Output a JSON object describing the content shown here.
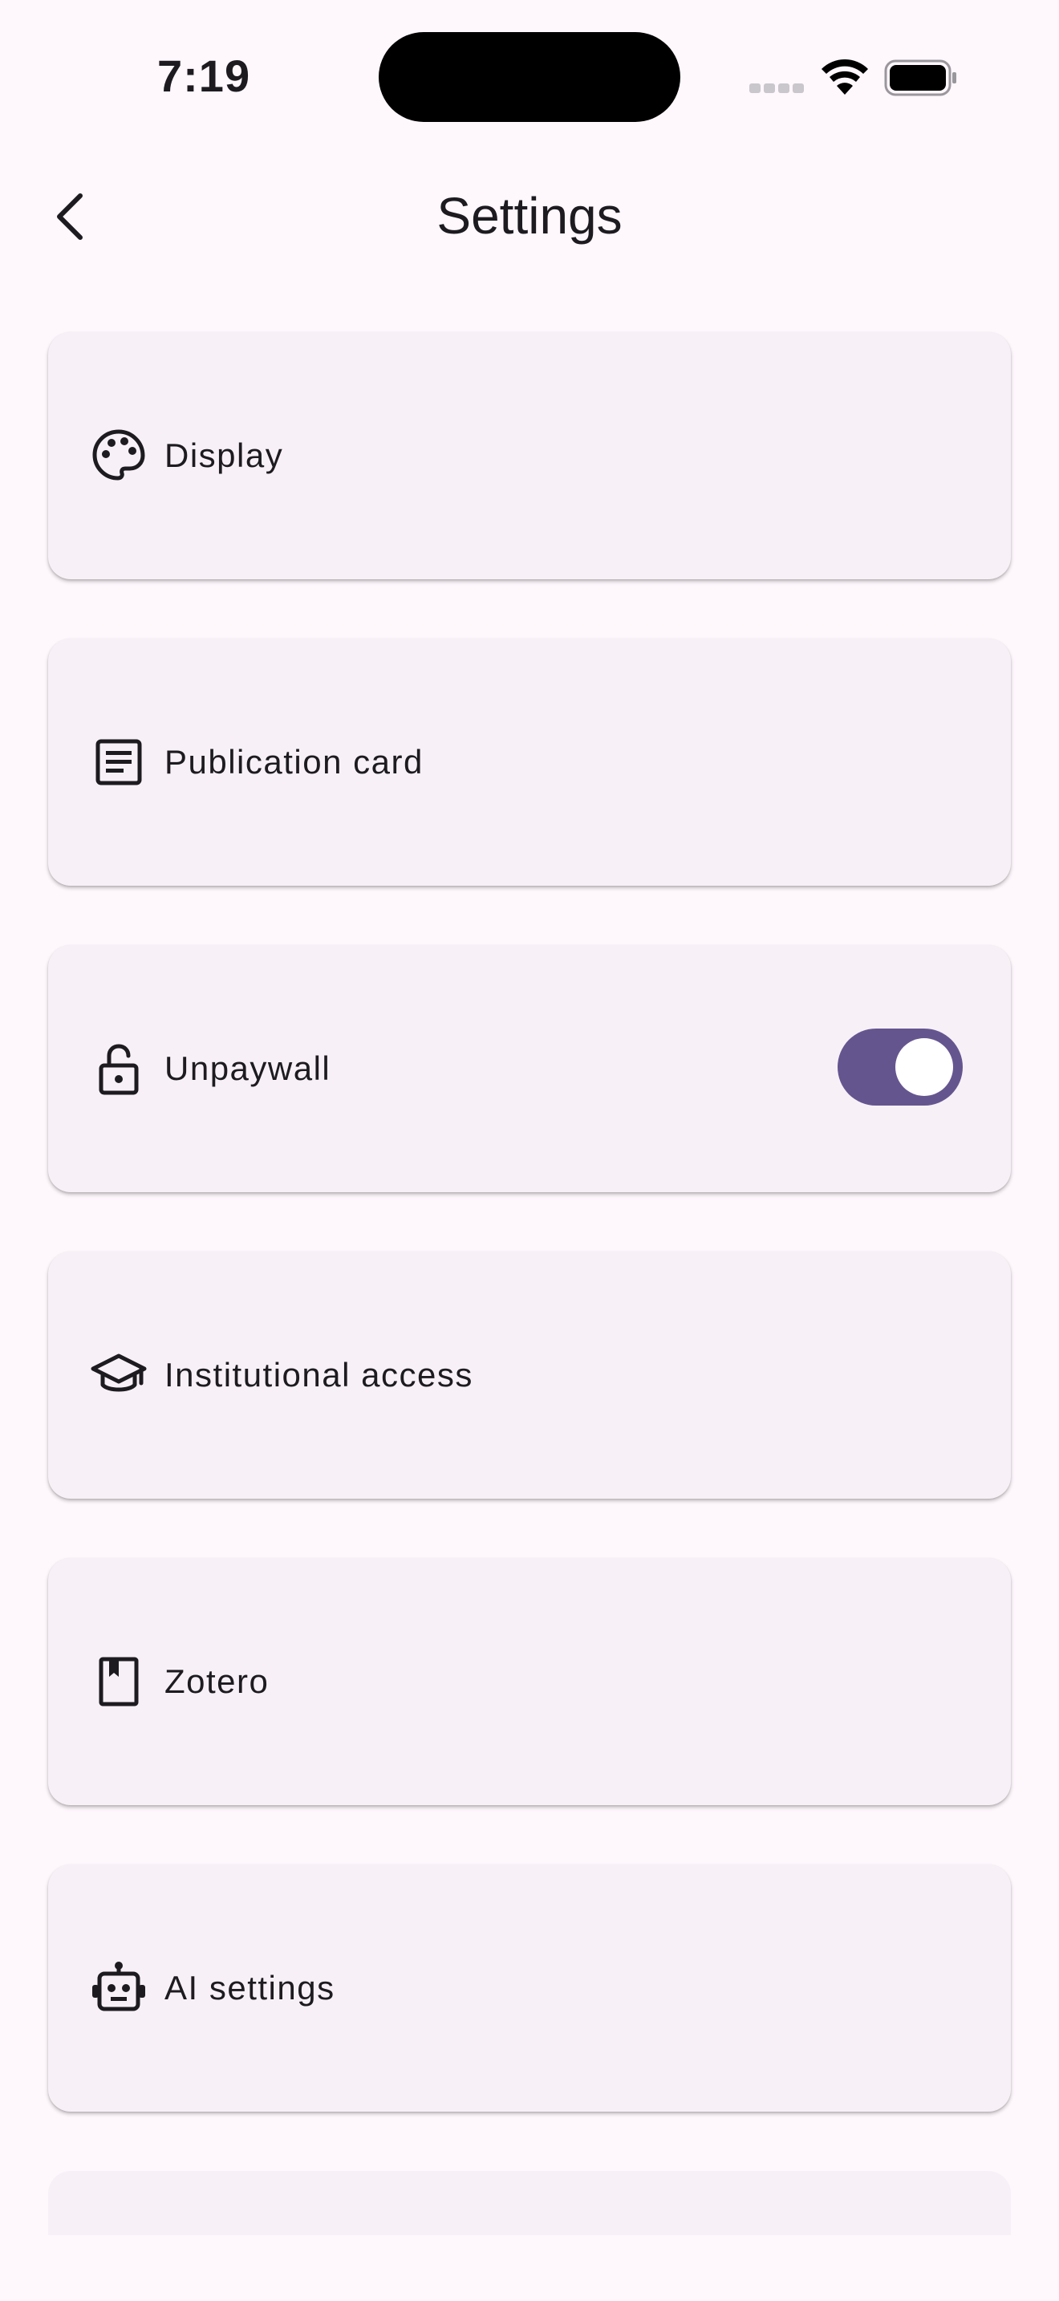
{
  "status_bar": {
    "time": "7:19"
  },
  "header": {
    "title": "Settings"
  },
  "settings": [
    {
      "id": "display",
      "label": "Display",
      "icon": "palette-icon"
    },
    {
      "id": "publication-card",
      "label": "Publication card",
      "icon": "article-icon"
    },
    {
      "id": "unpaywall",
      "label": "Unpaywall",
      "icon": "lock-open-icon",
      "toggle": true
    },
    {
      "id": "institutional-access",
      "label": "Institutional access",
      "icon": "school-icon"
    },
    {
      "id": "zotero",
      "label": "Zotero",
      "icon": "bookmark-book-icon"
    },
    {
      "id": "ai-settings",
      "label": "AI settings",
      "icon": "robot-icon"
    }
  ],
  "colors": {
    "background": "#fef7fc",
    "card": "#f7f1f7",
    "accent": "#65558f",
    "text": "#1d1b20"
  }
}
